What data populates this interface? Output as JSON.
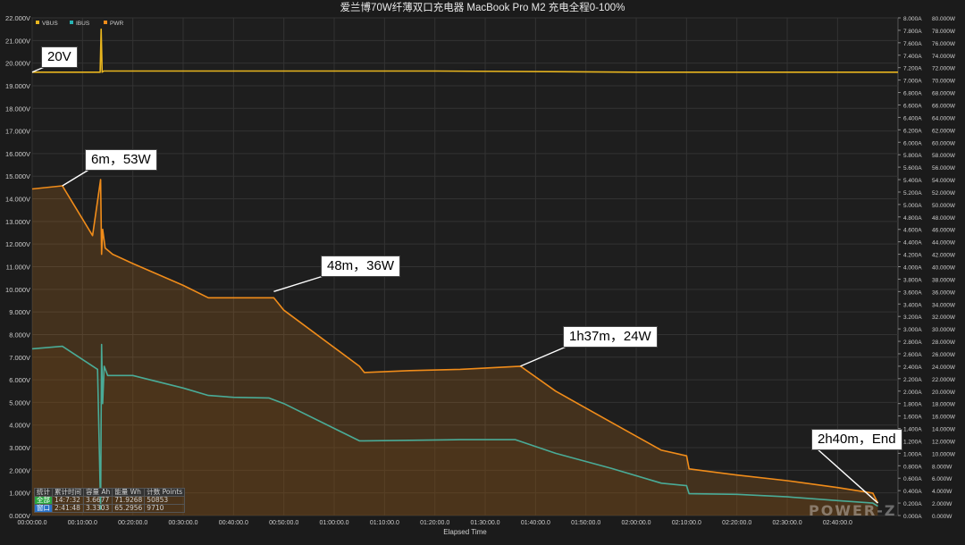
{
  "colors": {
    "vbus": "#e8b51e",
    "ibus": "#27b3b3",
    "pwr": "#f08c1a",
    "bg": "#1e1e1e",
    "grid": "#333333"
  },
  "chart_data": {
    "type": "line",
    "title": "爱兰博70W纤薄双口充电器 MacBook Pro M2 充电全程0-100%",
    "xlabel": "Elapsed Time",
    "legend": [
      "VBUS",
      "IBUS",
      "PWR"
    ],
    "legend_position": "top-left",
    "grid": true,
    "x_unit": "minutes",
    "xlim": [
      0,
      172
    ],
    "x_ticks": [
      "00:00:00.0",
      "00:10:00.0",
      "00:20:00.0",
      "00:30:00.0",
      "00:40:00.0",
      "00:50:00.0",
      "01:00:00.0",
      "01:10:00.0",
      "01:20:00.0",
      "01:30:00.0",
      "01:40:00.0",
      "01:50:00.0",
      "02:00:00.0",
      "02:10:00.0",
      "02:20:00.0",
      "02:30:00.0",
      "02:40:00.0"
    ],
    "left_axis": {
      "ylim": [
        0,
        22
      ],
      "ticks": [
        "0.000V",
        "1.000V",
        "2.000V",
        "3.000V",
        "4.000V",
        "5.000V",
        "6.000V",
        "7.000V",
        "8.000V",
        "9.000V",
        "10.000V",
        "11.000V",
        "12.000V",
        "13.000V",
        "14.000V",
        "15.000V",
        "16.000V",
        "17.000V",
        "18.000V",
        "19.000V",
        "20.000V",
        "21.000V",
        "22.000V"
      ]
    },
    "right_axis_current": {
      "ylim": [
        0,
        8
      ],
      "ticks": [
        "0.000A",
        "0.200A",
        "0.400A",
        "0.600A",
        "0.800A",
        "1.000A",
        "1.200A",
        "1.400A",
        "1.600A",
        "1.800A",
        "2.000A",
        "2.200A",
        "2.400A",
        "2.600A",
        "2.800A",
        "3.000A",
        "3.200A",
        "3.400A",
        "3.600A",
        "3.800A",
        "4.000A",
        "4.200A",
        "4.400A",
        "4.600A",
        "4.800A",
        "5.000A",
        "5.200A",
        "5.400A",
        "5.600A",
        "5.800A",
        "6.000A",
        "6.200A",
        "6.400A",
        "6.600A",
        "6.800A",
        "7.000A",
        "7.200A",
        "7.400A",
        "7.600A",
        "7.800A",
        "8.000A"
      ]
    },
    "right_axis_power": {
      "ylim": [
        0,
        80
      ],
      "ticks": [
        "0.000W",
        "2.000W",
        "4.000W",
        "6.000W",
        "8.000W",
        "10.000W",
        "12.000W",
        "14.000W",
        "16.000W",
        "18.000W",
        "20.000W",
        "22.000W",
        "24.000W",
        "26.000W",
        "28.000W",
        "30.000W",
        "32.000W",
        "34.000W",
        "36.000W",
        "38.000W",
        "40.000W",
        "42.000W",
        "44.000W",
        "46.000W",
        "48.000W",
        "50.000W",
        "52.000W",
        "54.000W",
        "56.000W",
        "58.000W",
        "60.000W",
        "62.000W",
        "64.000W",
        "66.000W",
        "68.000W",
        "70.000W",
        "72.000W",
        "74.000W",
        "76.000W",
        "78.000W",
        "80.000W"
      ]
    },
    "series": [
      {
        "name": "VBUS",
        "axis": "left",
        "color": "#e8b51e",
        "x": [
          0,
          13.5,
          13.7,
          13.9,
          14.2,
          40,
          80,
          120,
          160,
          172
        ],
        "y": [
          19.6,
          19.6,
          21.5,
          19.6,
          19.65,
          19.65,
          19.65,
          19.6,
          19.6,
          19.6
        ]
      },
      {
        "name": "IBUS",
        "axis": "right_current",
        "color": "#27b3b3",
        "x": [
          0,
          6,
          13,
          13.6,
          13.8,
          14.0,
          14.3,
          15,
          20,
          30,
          35,
          40,
          47,
          50,
          65,
          66,
          75,
          85,
          96,
          104,
          115,
          125,
          130,
          130.5,
          140,
          150,
          160,
          167,
          168
        ],
        "y": [
          2.68,
          2.72,
          2.35,
          0.1,
          2.75,
          1.8,
          2.4,
          2.25,
          2.25,
          2.05,
          1.93,
          1.9,
          1.89,
          1.8,
          1.2,
          1.2,
          1.21,
          1.22,
          1.22,
          1.0,
          0.76,
          0.52,
          0.48,
          0.35,
          0.34,
          0.3,
          0.24,
          0.2,
          0.15
        ]
      },
      {
        "name": "PWR",
        "axis": "right_power",
        "color": "#f08c1a",
        "x": [
          0,
          6,
          9,
          12,
          13.6,
          13.8,
          14.0,
          14.5,
          16,
          20,
          30,
          35,
          40,
          48,
          50,
          65,
          66,
          75,
          85,
          97,
          104,
          115,
          125,
          130,
          130.5,
          140,
          150,
          160,
          167,
          168
        ],
        "y": [
          52.5,
          53,
          49,
          45,
          54,
          42,
          46,
          43,
          42,
          40.5,
          37,
          35,
          35,
          35,
          33,
          24,
          23,
          23.3,
          23.5,
          24,
          20,
          15,
          10.5,
          9.6,
          7.5,
          6.5,
          5.6,
          4.5,
          3.6,
          2
        ]
      }
    ],
    "annotations": [
      {
        "text": "20V",
        "target_x": 0,
        "target_y_v": 19.6
      },
      {
        "text": "6m，53W",
        "target_x": 6,
        "target_y_w": 53
      },
      {
        "text": "48m，36W",
        "target_x": 48,
        "target_y_w": 36
      },
      {
        "text": "1h37m，24W",
        "target_x": 97,
        "target_y_w": 24
      },
      {
        "text": "2h40m，End",
        "target_x": 168,
        "target_y_w": 2
      }
    ]
  },
  "stats_table": {
    "headers": [
      "统计",
      "累计时间",
      "容量 Ah",
      "能量 Wh",
      "计数 Points"
    ],
    "rows": [
      [
        "全部",
        "14:7:32",
        "3.6677",
        "71.9268",
        "50853"
      ],
      [
        "窗口",
        "2:41:48",
        "3.3303",
        "65.2956",
        "9710"
      ]
    ]
  },
  "watermark": "POWER-Z"
}
